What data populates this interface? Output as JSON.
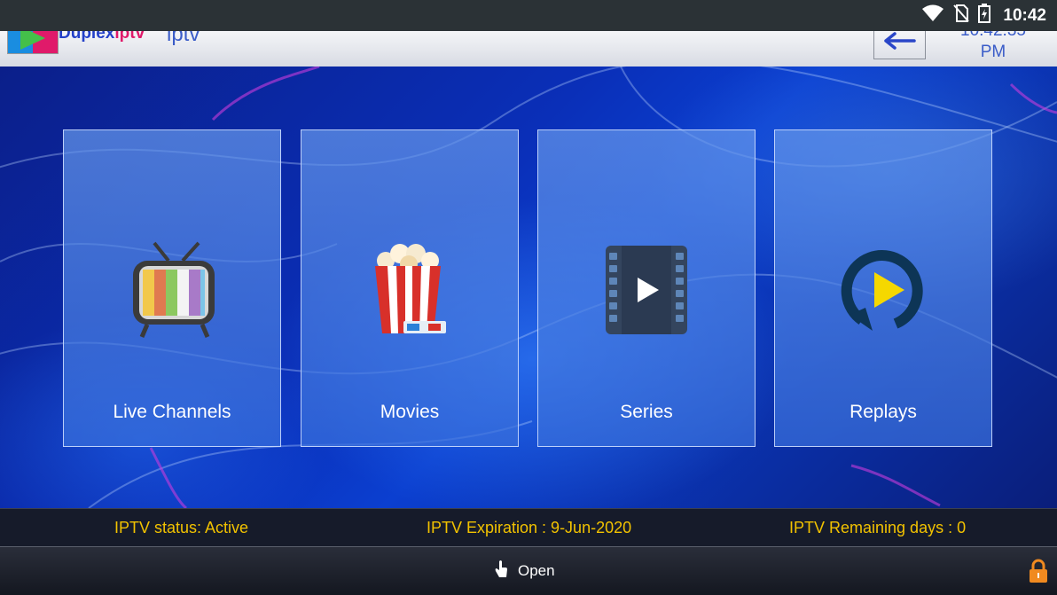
{
  "statusbar": {
    "time": "10:42",
    "icons": [
      "wifi-icon",
      "no-sim-icon",
      "battery-charging-icon"
    ]
  },
  "appbar": {
    "logo_text_1": "Duplex",
    "logo_text_2": "iptv",
    "app_name": "iptv",
    "clock_time": "10:42:35",
    "clock_ampm": "PM",
    "back_icon": "back-arrow-icon"
  },
  "tiles": [
    {
      "label": "Live Channels",
      "icon": "tv-icon"
    },
    {
      "label": "Movies",
      "icon": "popcorn-icon"
    },
    {
      "label": "Series",
      "icon": "film-play-icon"
    },
    {
      "label": "Replays",
      "icon": "replay-icon"
    }
  ],
  "info": {
    "status": "IPTV status: Active",
    "expiration": "IPTV Expiration : 9-Jun-2020",
    "remaining": "IPTV Remaining days : 0"
  },
  "bottombar": {
    "open_label": "Open",
    "open_icon": "hand-pointer-icon",
    "lock_icon": "lock-icon"
  },
  "colors": {
    "info_text": "#f2c200",
    "accent_blue": "#3a5cc8"
  }
}
